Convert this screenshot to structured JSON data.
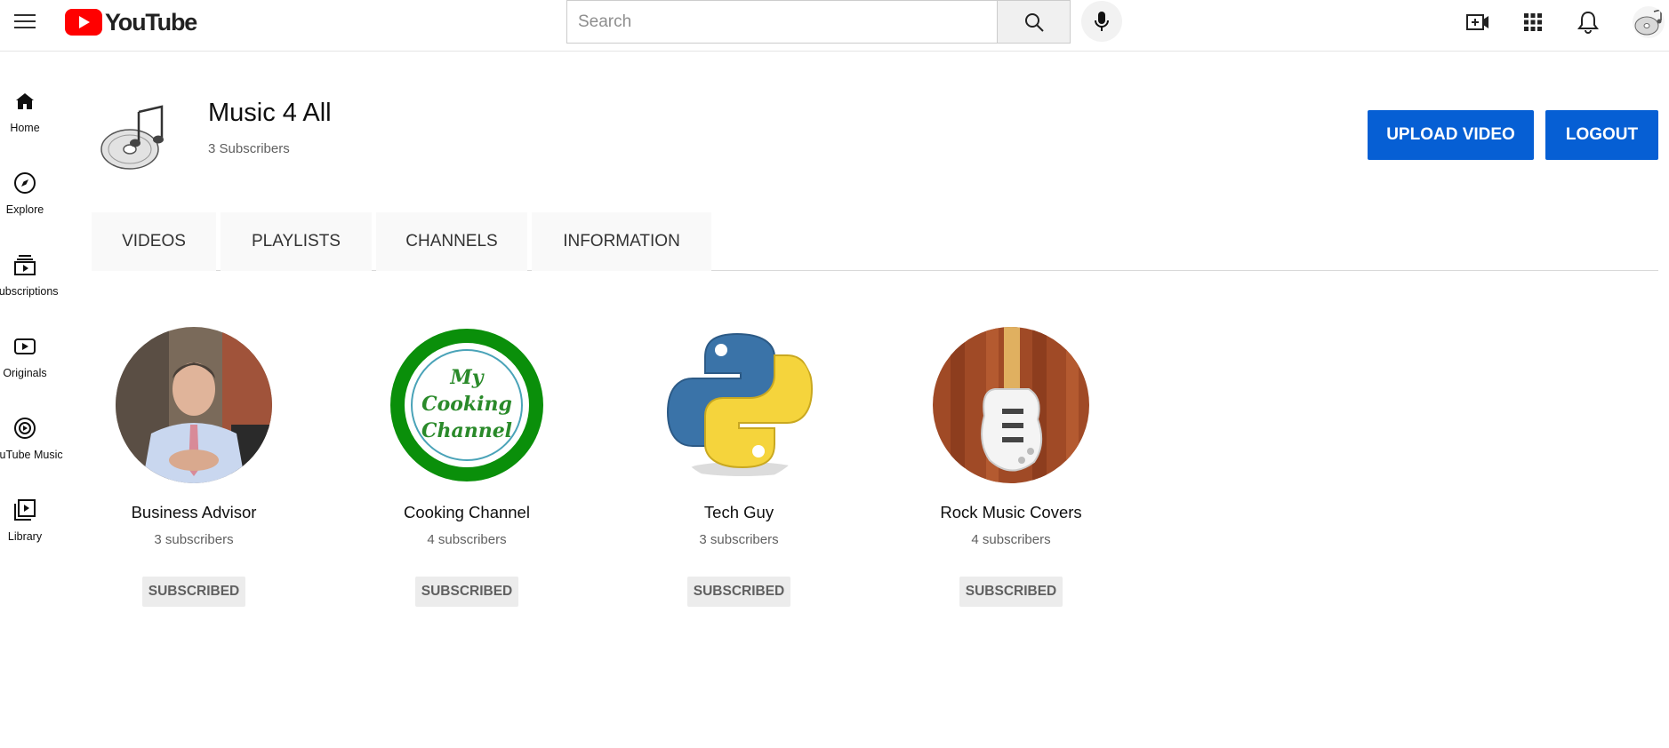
{
  "header": {
    "logo_text": "YouTube",
    "search_placeholder": "Search",
    "icons": [
      "menu-icon",
      "search-icon",
      "mic-icon",
      "create-video-icon",
      "apps-icon",
      "notifications-icon"
    ]
  },
  "sidebar": {
    "items": [
      {
        "label": "Home",
        "icon": "home-icon"
      },
      {
        "label": "Explore",
        "icon": "compass-icon"
      },
      {
        "label": "Subscriptions",
        "icon": "subscriptions-icon"
      },
      {
        "label": "Originals",
        "icon": "originals-icon"
      },
      {
        "label": "YouTube Music",
        "icon": "music-icon"
      },
      {
        "label": "Library",
        "icon": "library-icon"
      }
    ]
  },
  "channel": {
    "title": "Music 4 All",
    "subscribers": "3 Subscribers",
    "upload_label": "UPLOAD VIDEO",
    "logout_label": "LOGOUT"
  },
  "tabs": [
    {
      "label": "VIDEOS"
    },
    {
      "label": "PLAYLISTS"
    },
    {
      "label": "CHANNELS"
    },
    {
      "label": "INFORMATION"
    }
  ],
  "channels": [
    {
      "name": "Business Advisor",
      "subscribers": "3 subscribers",
      "button": "SUBSCRIBED"
    },
    {
      "name": "Cooking Channel",
      "subscribers": "4 subscribers",
      "button": "SUBSCRIBED",
      "logo_text": [
        "My",
        "Cooking",
        "Channel"
      ]
    },
    {
      "name": "Tech Guy",
      "subscribers": "3 subscribers",
      "button": "SUBSCRIBED"
    },
    {
      "name": "Rock Music Covers",
      "subscribers": "4 subscribers",
      "button": "SUBSCRIBED"
    }
  ],
  "colors": {
    "brand_red": "#ff0000",
    "accent_blue": "#065fd4",
    "cooking_green": "#0a8f0a"
  }
}
